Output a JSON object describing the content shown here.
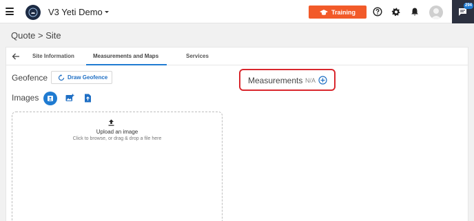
{
  "header": {
    "app_title": "V3 Yeti Demo",
    "training_label": "Training",
    "chat_badge": "294",
    "icons": [
      "menu-icon",
      "logo-icon",
      "chevron-down-icon",
      "help-icon",
      "gear-icon",
      "bell-icon",
      "avatar",
      "chat-icon"
    ]
  },
  "breadcrumb": "Quote > Site",
  "tabs": [
    {
      "label": "Site Information",
      "active": false
    },
    {
      "label": "Measurements and Maps",
      "active": true
    },
    {
      "label": "Services",
      "active": false
    }
  ],
  "geofence": {
    "label": "Geofence",
    "draw_label": "Draw Geofence"
  },
  "images": {
    "label": "Images",
    "upload_title": "Upload an image",
    "upload_subtitle": "Click to browse, or drag & drop a file here"
  },
  "measurements": {
    "label": "Measurements",
    "value": "N/A"
  },
  "colors": {
    "accent": "#1f7bd1",
    "training": "#f25a29",
    "highlight": "#d9262c"
  }
}
